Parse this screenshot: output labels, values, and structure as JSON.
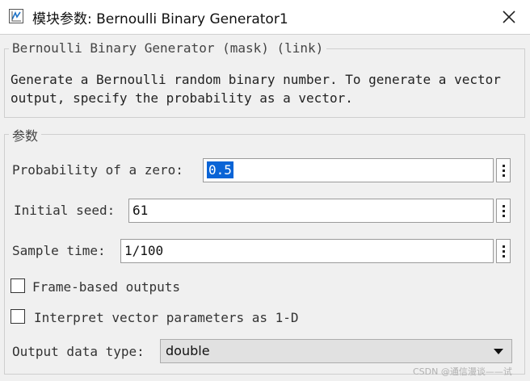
{
  "window": {
    "title": "模块参数: Bernoulli Binary Generator1"
  },
  "description_group": {
    "legend": "Bernoulli Binary Generator (mask) (link)",
    "text": "Generate a Bernoulli random binary number. To generate a vector output, specify the probability as a vector."
  },
  "params_group": {
    "legend": "参数",
    "probability": {
      "label": "Probability of a zero:",
      "value": "0.5"
    },
    "seed": {
      "label": "Initial seed:",
      "value": "61"
    },
    "sample_time": {
      "label": "Sample time:",
      "value": "1/100"
    },
    "frame_based": {
      "label": "Frame-based outputs",
      "checked": false
    },
    "interpret_1d": {
      "label": "Interpret vector parameters as 1-D",
      "checked": false
    },
    "output_type": {
      "label": "Output data type:",
      "value": "double"
    }
  },
  "watermark": "CSDN @通信漫谈——试"
}
